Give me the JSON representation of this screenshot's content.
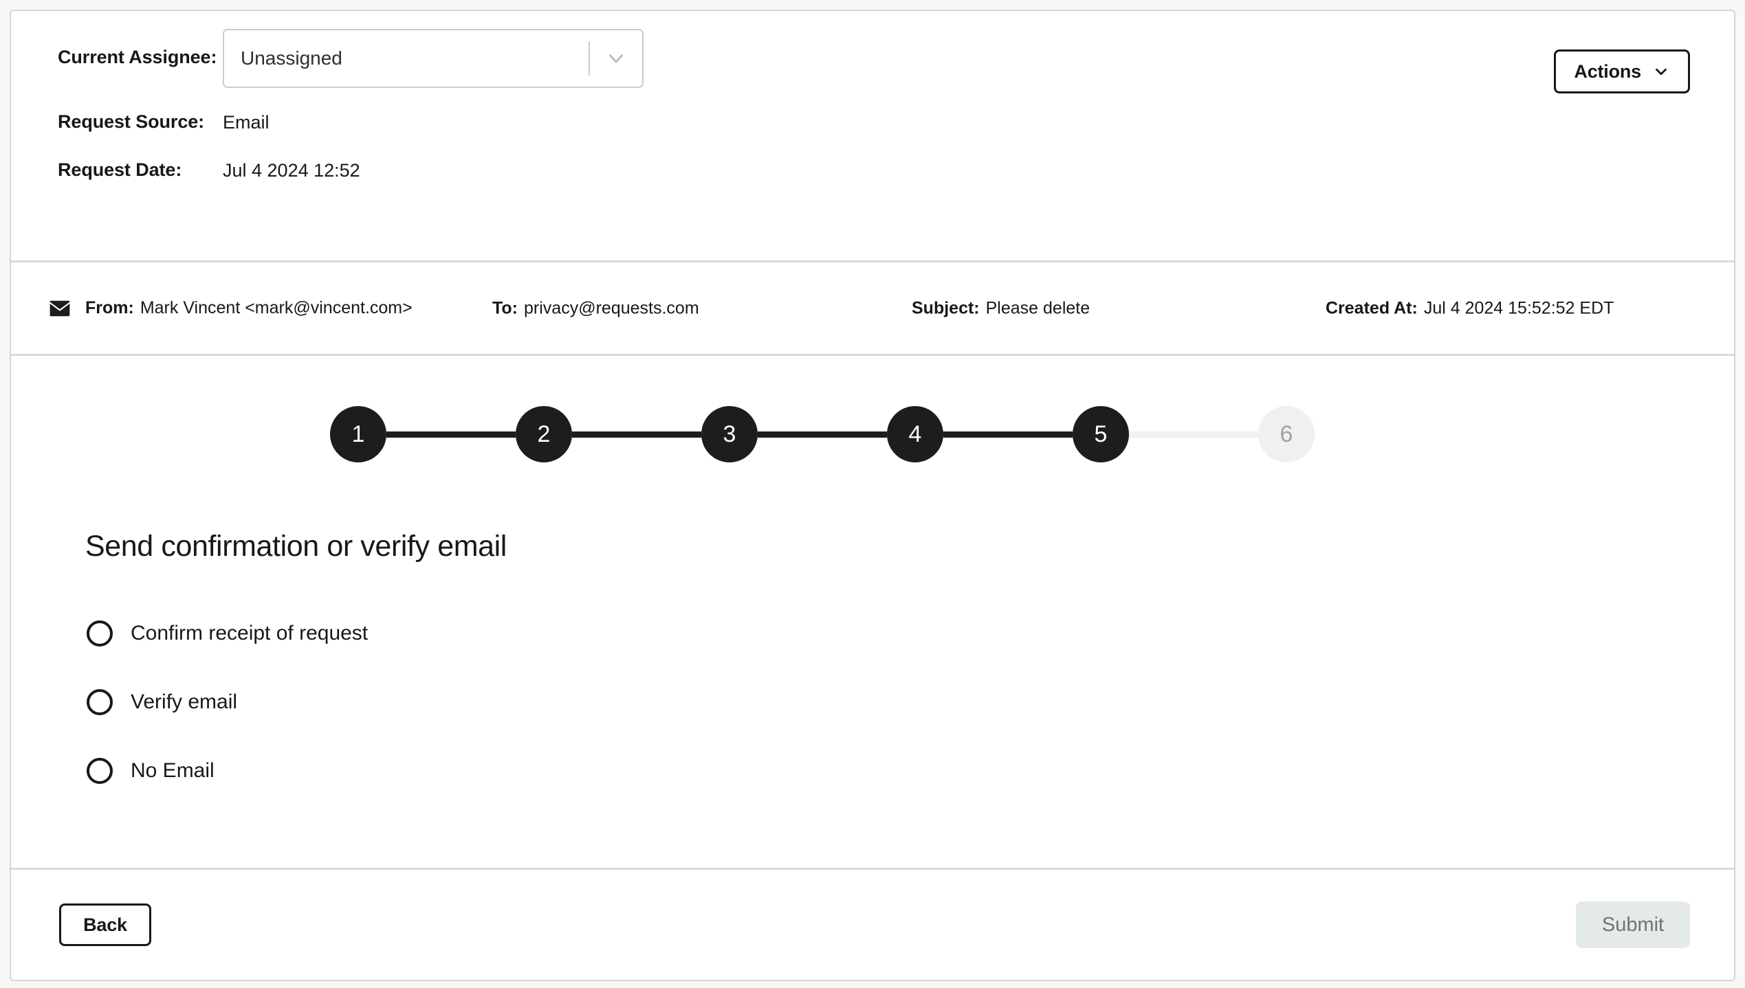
{
  "meta": {
    "assignee_label": "Current Assignee:",
    "assignee_value": "Unassigned",
    "source_label": "Request Source:",
    "source_value": "Email",
    "date_label": "Request Date:",
    "date_value": "Jul 4 2024 12:52",
    "actions_label": "Actions"
  },
  "email": {
    "from_label": "From:",
    "from_value": "Mark Vincent <mark@vincent.com>",
    "to_label": "To:",
    "to_value": "privacy@requests.com",
    "subject_label": "Subject:",
    "subject_value": "Please delete",
    "created_label": "Created At:",
    "created_value": "Jul 4 2024 15:52:52 EDT"
  },
  "stepper": {
    "steps": [
      {
        "number": "1",
        "state": "done"
      },
      {
        "number": "2",
        "state": "done"
      },
      {
        "number": "3",
        "state": "done"
      },
      {
        "number": "4",
        "state": "done"
      },
      {
        "number": "5",
        "state": "done"
      },
      {
        "number": "6",
        "state": "todo"
      }
    ]
  },
  "form": {
    "question": "Send confirmation or verify email",
    "options": [
      {
        "label": "Confirm receipt of request",
        "selected": false
      },
      {
        "label": "Verify email",
        "selected": false
      },
      {
        "label": "No Email",
        "selected": false
      }
    ]
  },
  "footer": {
    "back_label": "Back",
    "submit_label": "Submit",
    "submit_disabled": true
  },
  "colors": {
    "page_background": "#f7f8f8",
    "card_background": "#ffffff",
    "card_border": "#d3d5d6",
    "text": "#17181a",
    "step_done": "#1c1d1e",
    "step_todo": "#f0f0f0",
    "step_todo_text": "#a0a3a5",
    "submit_disabled_bg": "#e4eae5",
    "submit_disabled_text": "#6f7472",
    "select_border": "#cccccc"
  }
}
